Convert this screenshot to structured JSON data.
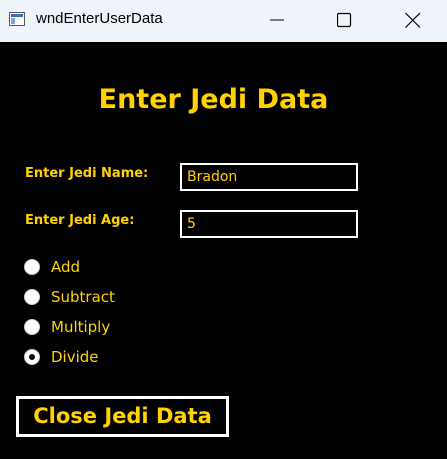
{
  "window": {
    "title": "wndEnterUserData"
  },
  "form": {
    "heading": "Enter Jedi Data",
    "name_label": "Enter Jedi Name:",
    "name_value": "Bradon",
    "age_label": "Enter Jedi Age:",
    "age_value": "5",
    "operations": [
      {
        "label": "Add",
        "checked": false
      },
      {
        "label": "Subtract",
        "checked": false
      },
      {
        "label": "Multiply",
        "checked": false
      },
      {
        "label": "Divide",
        "checked": true
      }
    ],
    "close_button_label": "Close Jedi Data"
  },
  "colors": {
    "accent": "#ffd200",
    "background": "#000000",
    "titlebar": "#eef4f9",
    "border": "#ffffff"
  },
  "icons": {
    "app": "app-window-icon",
    "minimize": "minimize-icon",
    "maximize": "maximize-icon",
    "close": "close-icon"
  }
}
